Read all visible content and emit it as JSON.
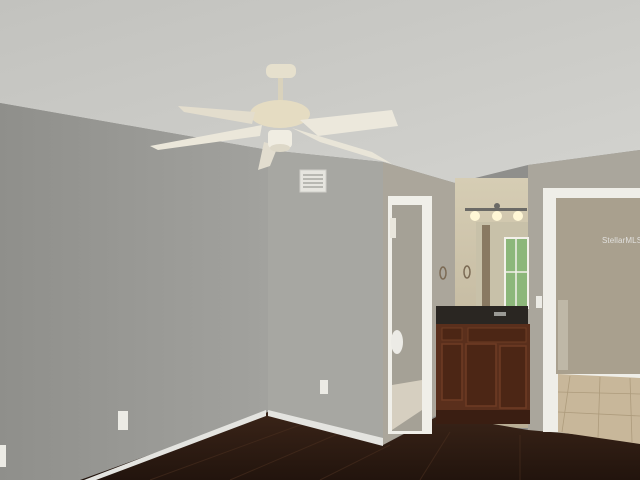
{
  "scene": {
    "description_free": true,
    "watermark": "StellarMLS",
    "colors": {
      "ceiling": "#c9c9c5",
      "left_wall": "#9a9a96",
      "center_wall": "#a9a9a4",
      "right_wall": "#b2ada2",
      "floor": "#2b1a12",
      "baseboard": "#e4e4e0",
      "cabinet": "#5a2f1c",
      "countertop": "#2a2622",
      "tile": "#c8b79a",
      "fan": "#e8e3d4"
    }
  }
}
